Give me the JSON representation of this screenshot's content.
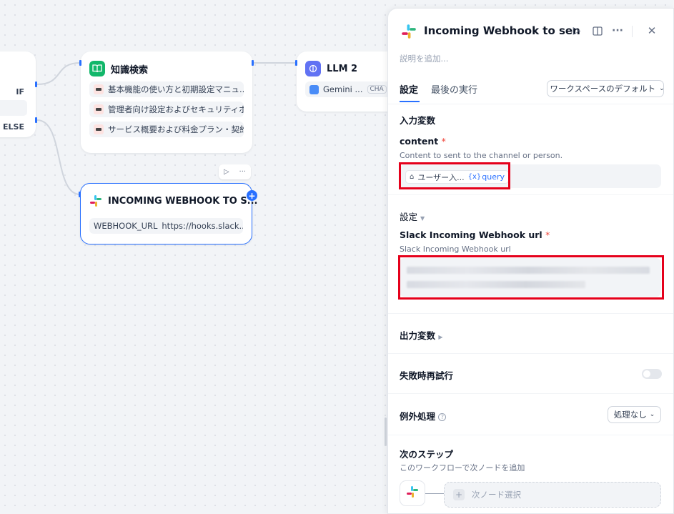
{
  "canvas": {
    "if_node": {
      "if_label": "IF",
      "else_label": "ELSE"
    },
    "knowledge_node": {
      "title": "知識検索",
      "items": [
        "基本機能の使い方と初期設定マニュ...",
        "管理者向け設定およびセキュリティポ...",
        "サービス概要および料金プラン・契約ガ..."
      ]
    },
    "llm_node": {
      "title": "LLM 2",
      "model": "Gemini ...",
      "mode_badge": "CHA"
    },
    "webhook_node": {
      "title": "INCOMING WEBHOOK TO S...",
      "param_key": "WEBHOOK_URL",
      "param_value": "https://hooks.slack...."
    }
  },
  "panel": {
    "title": "Incoming Webhook to sen",
    "description_placeholder": "説明を追加...",
    "tabs": [
      {
        "label": "設定",
        "active": true
      },
      {
        "label": "最後の実行",
        "active": false
      }
    ],
    "workspace_select": "ワークスペースのデフォルト",
    "input_vars": {
      "heading": "入力変数",
      "field_label": "content",
      "required_mark": "*",
      "field_desc": "Content to sent to the channel or person.",
      "tag_source": "ユーザー入...",
      "tag_var": "query",
      "tag_var_prefix": "{x}"
    },
    "settings": {
      "heading": "設定",
      "field_label": "Slack Incoming Webhook url",
      "required_mark": "*",
      "field_desc": "Slack Incoming Webhook url"
    },
    "output_vars": {
      "heading": "出力変数"
    },
    "retry": {
      "label": "失敗時再試行",
      "enabled": false
    },
    "exception": {
      "label": "例外処理",
      "value": "処理なし"
    },
    "next_step": {
      "heading": "次のステップ",
      "desc": "このワークフローで次ノードを追加",
      "select_label": "次ノード選択"
    }
  },
  "colors": {
    "accent": "#2970ff",
    "highlight": "#e5001b",
    "status_green": "#12b76a"
  }
}
